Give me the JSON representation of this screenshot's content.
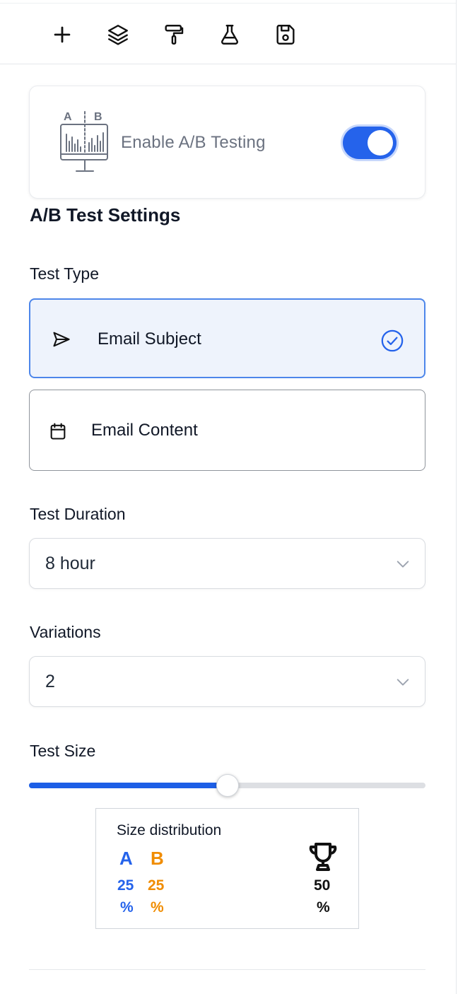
{
  "toolbar": {
    "items": [
      {
        "name": "add",
        "icon": "plus-icon"
      },
      {
        "name": "layers",
        "icon": "layers-icon"
      },
      {
        "name": "style",
        "icon": "paint-roller-icon"
      },
      {
        "name": "test",
        "icon": "flask-icon"
      },
      {
        "name": "save",
        "icon": "save-icon"
      }
    ]
  },
  "ab_card": {
    "label": "Enable A/B Testing",
    "icon": "ab-testing-chart-icon",
    "icon_letters": {
      "a": "A",
      "b": "B"
    },
    "enabled": true
  },
  "settings": {
    "title": "A/B Test Settings",
    "test_type": {
      "label": "Test Type",
      "options": [
        {
          "label": "Email Subject",
          "icon": "send-icon",
          "selected": true
        },
        {
          "label": "Email Content",
          "icon": "calendar-icon",
          "selected": false
        }
      ]
    },
    "duration": {
      "label": "Test Duration",
      "value": "8 hour"
    },
    "variations": {
      "label": "Variations",
      "value": "2"
    },
    "test_size": {
      "label": "Test Size",
      "value_percent": 50
    }
  },
  "distribution": {
    "title": "Size distribution",
    "a": {
      "letter": "A",
      "value": "25",
      "unit": "%"
    },
    "b": {
      "letter": "B",
      "value": "25",
      "unit": "%"
    },
    "winner": {
      "icon": "trophy-icon",
      "value": "50",
      "unit": "%"
    }
  },
  "colors": {
    "accent": "#2563eb",
    "variant_a": "#2563eb",
    "variant_b": "#f08c00",
    "selected_bg": "#eef3fc"
  }
}
